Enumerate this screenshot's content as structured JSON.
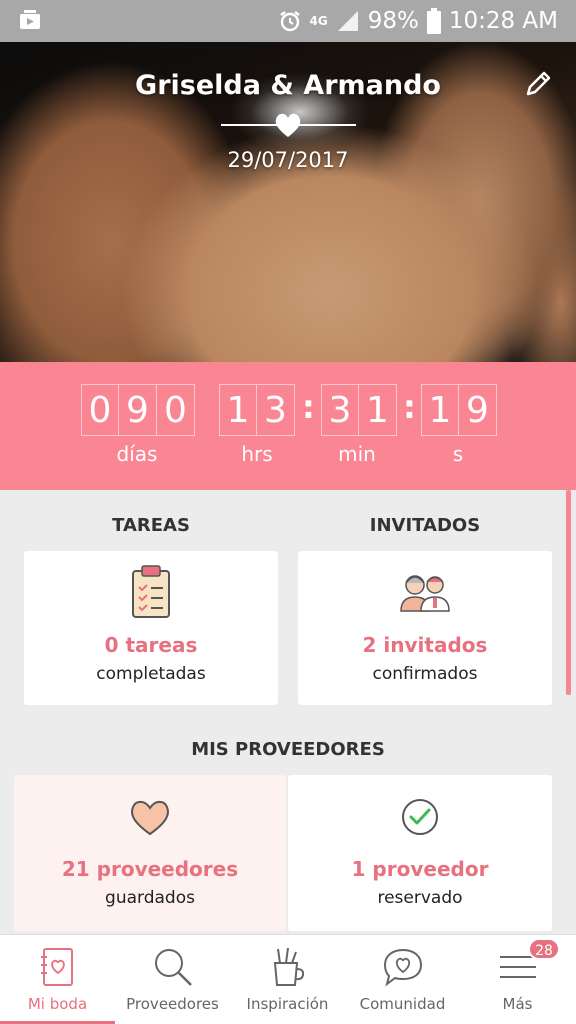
{
  "status_bar": {
    "network": "4G",
    "battery": "98%",
    "time": "10:28 AM"
  },
  "header": {
    "couple": "Griselda & Armando",
    "date": "29/07/2017"
  },
  "countdown": {
    "days": [
      "0",
      "9",
      "0"
    ],
    "hours": [
      "1",
      "3"
    ],
    "minutes": [
      "3",
      "1"
    ],
    "seconds": [
      "1",
      "9"
    ],
    "labels": {
      "days": "días",
      "hours": "hrs",
      "minutes": "min",
      "seconds": "s"
    }
  },
  "tasks": {
    "heading": "TAREAS",
    "count": "0 tareas",
    "sub": "completadas"
  },
  "guests": {
    "heading": "INVITADOS",
    "count": "2 invitados",
    "sub": "confirmados"
  },
  "vendors": {
    "heading": "MIS PROVEEDORES",
    "saved": {
      "count": "21 proveedores",
      "sub": "guardados"
    },
    "booked": {
      "count": "1 proveedor",
      "sub": "reservado"
    }
  },
  "nav": {
    "items": [
      {
        "label": "Mi boda"
      },
      {
        "label": "Proveedores"
      },
      {
        "label": "Inspiración"
      },
      {
        "label": "Comunidad"
      },
      {
        "label": "Más"
      }
    ],
    "badge": "28"
  },
  "colors": {
    "accent": "#fa8694",
    "accent_text": "#e7717e"
  }
}
